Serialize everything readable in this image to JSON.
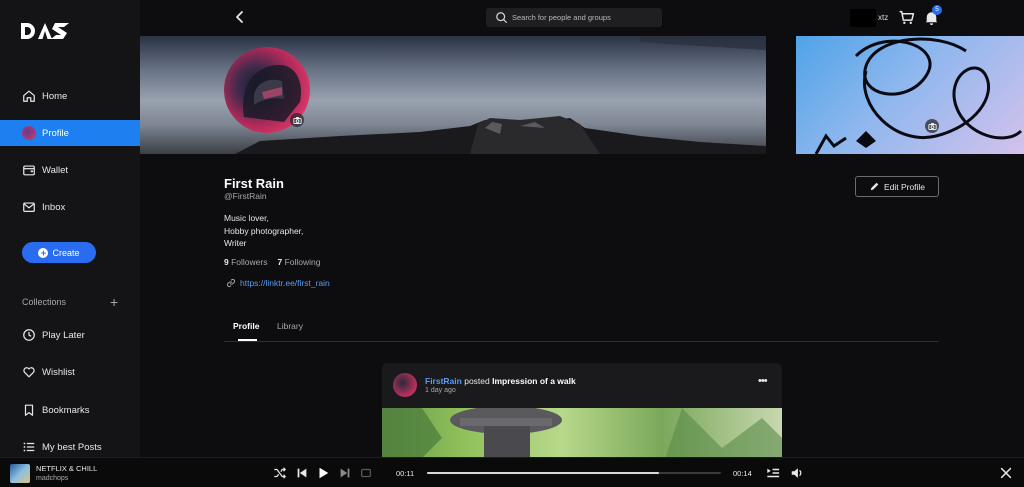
{
  "sidebar": {
    "logo_alt": "DAS",
    "nav": [
      {
        "label": "Home",
        "icon": "home-icon"
      },
      {
        "label": "Profile",
        "icon": "avatar",
        "active": true
      },
      {
        "label": "Wallet",
        "icon": "wallet-icon"
      },
      {
        "label": "Inbox",
        "icon": "mail-icon"
      }
    ],
    "create_label": "Create",
    "collections_label": "Collections",
    "collections": [
      {
        "label": "Play Later",
        "icon": "clock-icon"
      },
      {
        "label": "Wishlist",
        "icon": "heart-icon"
      },
      {
        "label": "Bookmarks",
        "icon": "bookmark-icon"
      },
      {
        "label": "My best Posts",
        "icon": "list-icon"
      }
    ]
  },
  "topbar": {
    "search_placeholder": "Search for people and groups",
    "user_label": "xtz",
    "notification_count": "5"
  },
  "profile": {
    "name": "First Rain",
    "handle": "@FirstRain",
    "bio": [
      "Music lover,",
      "Hobby photographer,",
      "Writer"
    ],
    "followers_count": "9",
    "followers_label": "Followers",
    "following_count": "7",
    "following_label": "Following",
    "link": "https://linktr.ee/first_rain",
    "edit_label": "Edit Profile"
  },
  "tabs": [
    {
      "label": "Profile",
      "active": true
    },
    {
      "label": "Library",
      "active": false
    }
  ],
  "post": {
    "author": "FirstRain",
    "verb": "posted",
    "title": "Impression of a walk",
    "time": "1 day ago",
    "more": "•••"
  },
  "player": {
    "track_title": "NETFLIX & CHILL",
    "track_artist": "madchops",
    "elapsed": "00:11",
    "remaining": "00:14",
    "progress": 0.79
  },
  "colors": {
    "accent": "#1d7ff0",
    "link": "#5a9bf5",
    "background": "#0d0d0f",
    "sidebar": "#141416"
  }
}
